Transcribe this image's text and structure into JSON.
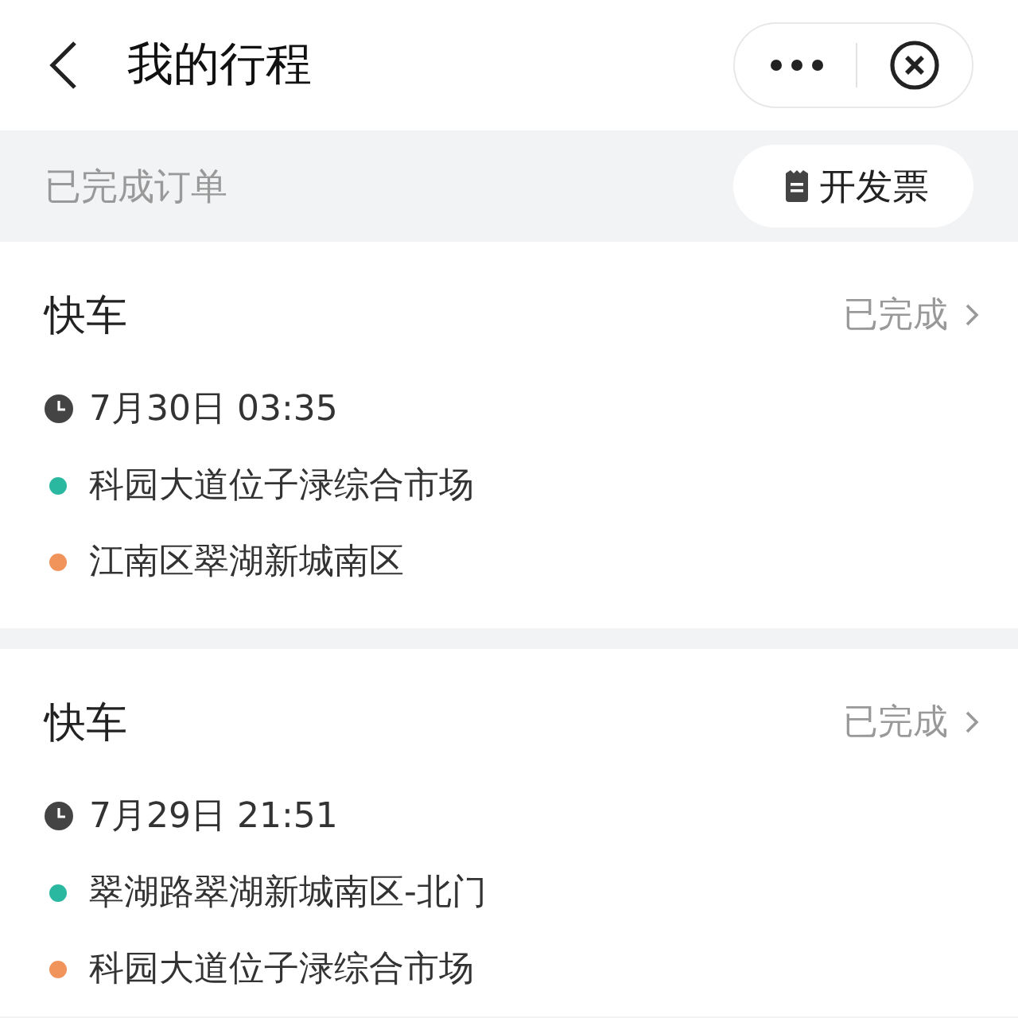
{
  "header": {
    "title": "我的行程"
  },
  "section": {
    "label": "已完成订单",
    "invoice_button": "开发票"
  },
  "trips": [
    {
      "type": "快车",
      "status": "已完成",
      "time": "7月30日 03:35",
      "stops": [
        {
          "name": "科园大道位子渌综合市场",
          "color": "#2bb8a0"
        },
        {
          "name": "江南区翠湖新城南区",
          "color": "#f0945c"
        }
      ]
    },
    {
      "type": "快车",
      "status": "已完成",
      "time": "7月29日 21:51",
      "stops": [
        {
          "name": "翠湖路翠湖新城南区-北门",
          "color": "#2bb8a0"
        },
        {
          "name": "科园大道位子渌综合市场",
          "color": "#f0945c"
        }
      ]
    }
  ]
}
